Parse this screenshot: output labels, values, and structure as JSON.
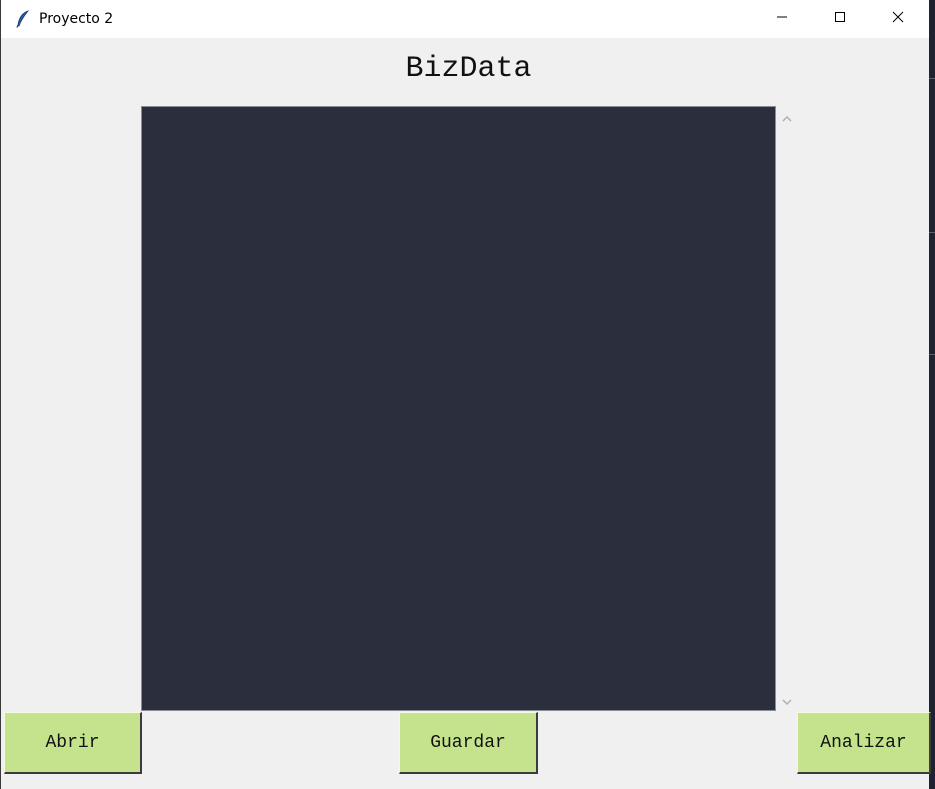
{
  "window": {
    "title": "Proyecto 2",
    "icon": "feather-icon"
  },
  "controls": {
    "minimize_icon": "minimize-icon",
    "maximize_icon": "maximize-icon",
    "close_icon": "close-icon"
  },
  "main": {
    "heading": "BizData",
    "editor_value": ""
  },
  "buttons": {
    "open_label": "Abrir",
    "save_label": "Guardar",
    "analyze_label": "Analizar"
  },
  "colors": {
    "button_bg": "#c5e38d",
    "editor_bg": "#2b2e3d",
    "window_bg": "#f0f0f0"
  }
}
